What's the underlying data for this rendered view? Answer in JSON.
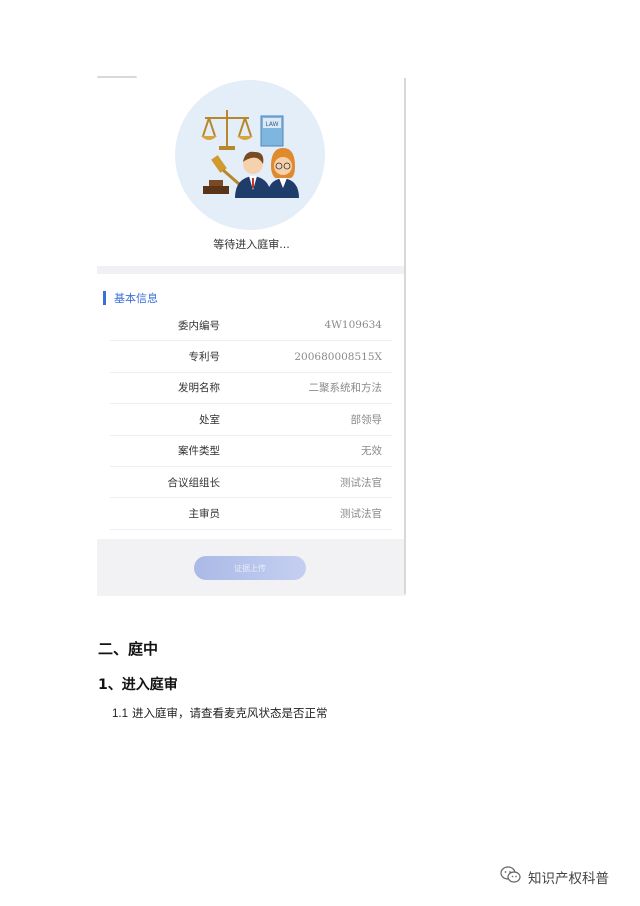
{
  "illustration": {
    "badge_text": "LAW"
  },
  "waiting_text": "等待进入庭审...",
  "basic_info": {
    "title": "基本信息",
    "rows": [
      {
        "label": "委内编号",
        "value": "4W109634"
      },
      {
        "label": "专利号",
        "value": "200680008515X"
      },
      {
        "label": "发明名称",
        "value": "二聚系统和方法"
      },
      {
        "label": "处室",
        "value": "部领导"
      },
      {
        "label": "案件类型",
        "value": "无效"
      },
      {
        "label": "合议组组长",
        "value": "测试法官"
      },
      {
        "label": "主审员",
        "value": "测试法官"
      }
    ]
  },
  "upload_button": "证据上传",
  "doc": {
    "heading2": "二、庭中",
    "heading3": "1、进入庭审",
    "para_num": "1.1",
    "para_text": "进入庭审，请查看麦克风状态是否正常"
  },
  "watermark": {
    "text": "知识产权科普",
    "icon": "wechat-icon"
  },
  "colors": {
    "accent": "#3b6fd8",
    "circle_bg": "#e3eef9"
  }
}
